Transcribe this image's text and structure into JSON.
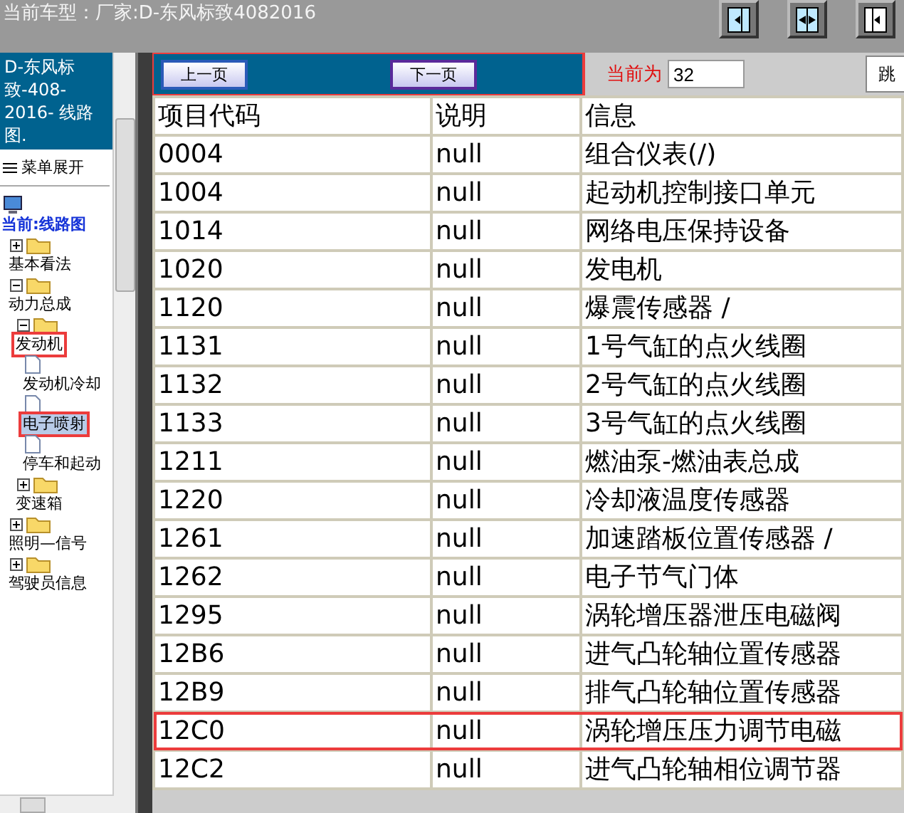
{
  "title": "当前车型：厂家:D-东风标致4082016",
  "view_buttons": [
    {
      "kind": "left"
    },
    {
      "kind": "split"
    },
    {
      "kind": "right"
    }
  ],
  "sidebar": {
    "header": "D-东风标致-408-2016- 线路图.",
    "menu_toggle": "菜单展开",
    "tree": [
      {
        "label": "当前:线路图",
        "kind": "root",
        "annotated": false,
        "selected": false,
        "children": [
          {
            "label": "基本看法",
            "kind": "folder",
            "expanded": false,
            "annotated": false,
            "selected": false
          },
          {
            "label": "动力总成",
            "kind": "folder",
            "expanded": true,
            "annotated": false,
            "selected": false,
            "children": [
              {
                "label": "发动机",
                "kind": "folder",
                "expanded": true,
                "annotated": true,
                "selected": false,
                "children": [
                  {
                    "label": "发动机冷却",
                    "kind": "doc",
                    "annotated": false,
                    "selected": false
                  },
                  {
                    "label": "电子喷射",
                    "kind": "doc",
                    "annotated": true,
                    "selected": true
                  },
                  {
                    "label": "停车和起动",
                    "kind": "doc",
                    "annotated": false,
                    "selected": false
                  }
                ]
              },
              {
                "label": "变速箱",
                "kind": "folder",
                "expanded": false,
                "annotated": false,
                "selected": false
              }
            ]
          },
          {
            "label": "照明—信号",
            "kind": "folder",
            "expanded": false,
            "annotated": false,
            "selected": false
          },
          {
            "label": "驾驶员信息",
            "kind": "folder",
            "expanded": false,
            "annotated": false,
            "selected": false
          }
        ]
      }
    ]
  },
  "pager": {
    "annotated": true,
    "prev": "上一页",
    "next": "下一页",
    "current_label": "当前为",
    "current_value": "32",
    "jump": "跳"
  },
  "table": {
    "columns": [
      "项目代码",
      "说明",
      "信息"
    ],
    "rows": [
      {
        "cells": [
          "0004",
          "null",
          "组合仪表(/)"
        ],
        "annotated": false
      },
      {
        "cells": [
          "1004",
          "null",
          "起动机控制接口单元"
        ],
        "annotated": false
      },
      {
        "cells": [
          "1014",
          "null",
          "网络电压保持设备"
        ],
        "annotated": false
      },
      {
        "cells": [
          "1020",
          "null",
          "发电机"
        ],
        "annotated": false
      },
      {
        "cells": [
          "1120",
          "null",
          "爆震传感器 /"
        ],
        "annotated": false
      },
      {
        "cells": [
          "1131",
          "null",
          "1号气缸的点火线圈"
        ],
        "annotated": false
      },
      {
        "cells": [
          "1132",
          "null",
          "2号气缸的点火线圈"
        ],
        "annotated": false
      },
      {
        "cells": [
          "1133",
          "null",
          "3号气缸的点火线圈"
        ],
        "annotated": false
      },
      {
        "cells": [
          "1211",
          "null",
          "燃油泵-燃油表总成"
        ],
        "annotated": false
      },
      {
        "cells": [
          "1220",
          "null",
          "冷却液温度传感器"
        ],
        "annotated": false
      },
      {
        "cells": [
          "1261",
          "null",
          "加速踏板位置传感器 /"
        ],
        "annotated": false
      },
      {
        "cells": [
          "1262",
          "null",
          "电子节气门体"
        ],
        "annotated": false
      },
      {
        "cells": [
          "1295",
          "null",
          "涡轮增压器泄压电磁阀"
        ],
        "annotated": false
      },
      {
        "cells": [
          "12B6",
          "null",
          "进气凸轮轴位置传感器"
        ],
        "annotated": false
      },
      {
        "cells": [
          "12B9",
          "null",
          "排气凸轮轴位置传感器"
        ],
        "annotated": false
      },
      {
        "cells": [
          "12C0",
          "null",
          "涡轮增压压力调节电磁"
        ],
        "annotated": true
      },
      {
        "cells": [
          "12C2",
          "null",
          "进气凸轮轴相位调节器"
        ],
        "annotated": false
      }
    ]
  }
}
